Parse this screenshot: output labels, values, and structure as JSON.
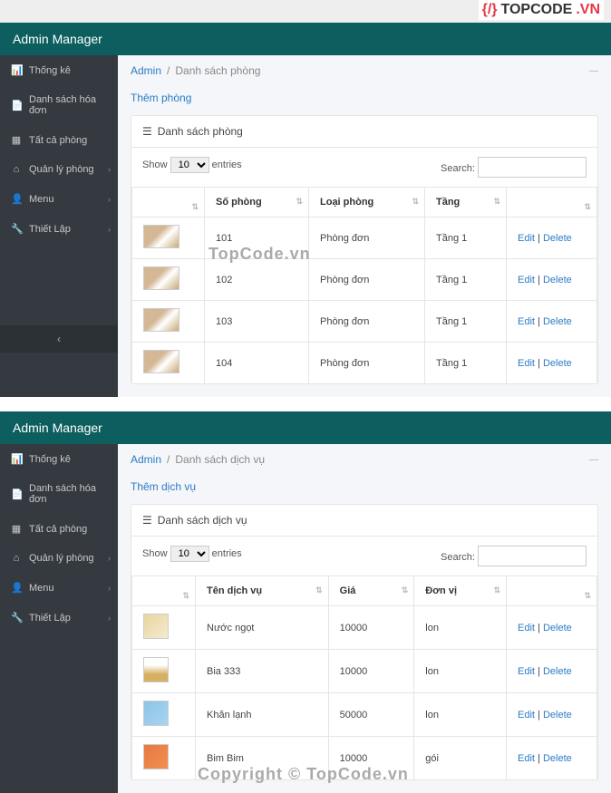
{
  "logo": {
    "text": "TOPCODE",
    "suffix": ".VN"
  },
  "watermarks": {
    "top": "TopCode.vn",
    "bottom": "Copyright © TopCode.vn"
  },
  "sidebar": {
    "title": "Admin Manager",
    "items": [
      {
        "label": "Thống kê"
      },
      {
        "label": "Danh sách hóa đơn"
      },
      {
        "label": "Tất cả phòng"
      },
      {
        "label": "Quản lý phòng"
      },
      {
        "label": "Menu"
      },
      {
        "label": "Thiết Lập"
      }
    ]
  },
  "panel1": {
    "breadcrumb": {
      "root": "Admin",
      "current": "Danh sách phòng"
    },
    "add_link": "Thêm phòng",
    "list_title": "Danh sách phòng",
    "table_ctrl": {
      "show": "Show",
      "entries": "entries",
      "count": "10",
      "search": "Search:"
    },
    "columns": [
      "",
      "Số phòng",
      "Loại phòng",
      "Tầng",
      ""
    ],
    "rows": [
      {
        "so": "101",
        "loai": "Phòng đơn",
        "tang": "Tầng 1"
      },
      {
        "so": "102",
        "loai": "Phòng đơn",
        "tang": "Tầng 1"
      },
      {
        "so": "103",
        "loai": "Phòng đơn",
        "tang": "Tầng 1"
      },
      {
        "so": "104",
        "loai": "Phòng đơn",
        "tang": "Tầng 1"
      }
    ],
    "actions": {
      "edit": "Edit",
      "del": "Delete"
    }
  },
  "panel2": {
    "breadcrumb": {
      "root": "Admin",
      "current": "Danh sách dịch vụ"
    },
    "add_link": "Thêm dịch vụ",
    "list_title": "Danh sách dịch vụ",
    "table_ctrl": {
      "show": "Show",
      "entries": "entries",
      "count": "10",
      "search": "Search:"
    },
    "columns": [
      "",
      "Tên dịch vụ",
      "Giá",
      "Đơn vị",
      ""
    ],
    "rows": [
      {
        "ten": "Nước ngọt",
        "gia": "10000",
        "dv": "lon"
      },
      {
        "ten": "Bia 333",
        "gia": "10000",
        "dv": "lon"
      },
      {
        "ten": "Khăn lạnh",
        "gia": "50000",
        "dv": "lon"
      },
      {
        "ten": "Bim Bim",
        "gia": "10000",
        "dv": "gói"
      }
    ],
    "actions": {
      "edit": "Edit",
      "del": "Delete"
    }
  }
}
